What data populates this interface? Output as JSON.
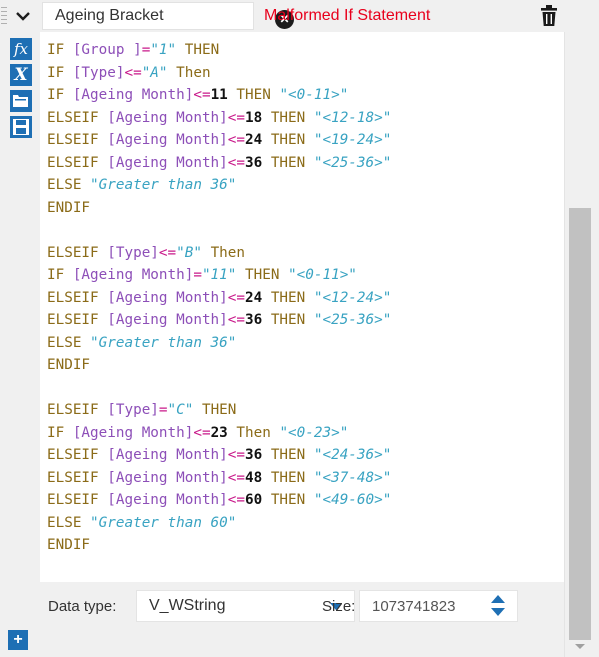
{
  "header": {
    "name_value": "Ageing Bracket",
    "error_message": "Malformed If Statement",
    "error_color": "#e8001c",
    "icons": [
      "chevron-down-icon",
      "error-icon",
      "trash-icon"
    ]
  },
  "toolbar": {
    "fx_glyph": "fx",
    "variable_glyph": "X",
    "add_glyph": "+",
    "icons": [
      "function-icon",
      "variable-icon",
      "folder-icon",
      "save-icon",
      "add-icon"
    ],
    "accent_color": "#1e6fb4"
  },
  "editor": {
    "lines": [
      [
        [
          "k",
          "IF "
        ],
        [
          "f",
          "[Group ]"
        ],
        [
          "o",
          "="
        ],
        [
          "s",
          "\"1\""
        ],
        [
          "k",
          " THEN"
        ]
      ],
      [
        [
          "k",
          "IF "
        ],
        [
          "f",
          "[Type]"
        ],
        [
          "o",
          "<="
        ],
        [
          "s",
          "\"A\""
        ],
        [
          "k",
          " Then"
        ]
      ],
      [
        [
          "k",
          "IF "
        ],
        [
          "f",
          "[Ageing Month]"
        ],
        [
          "o",
          "<="
        ],
        [
          "n",
          "11"
        ],
        [
          "k",
          " THEN "
        ],
        [
          "s",
          "\"<0-11>\""
        ]
      ],
      [
        [
          "k",
          "ELSEIF "
        ],
        [
          "f",
          "[Ageing Month]"
        ],
        [
          "o",
          "<="
        ],
        [
          "n",
          "18"
        ],
        [
          "k",
          " THEN "
        ],
        [
          "s",
          "\"<12-18>\""
        ]
      ],
      [
        [
          "k",
          "ELSEIF "
        ],
        [
          "f",
          "[Ageing Month]"
        ],
        [
          "o",
          "<="
        ],
        [
          "n",
          "24"
        ],
        [
          "k",
          " THEN "
        ],
        [
          "s",
          "\"<19-24>\""
        ]
      ],
      [
        [
          "k",
          "ELSEIF "
        ],
        [
          "f",
          "[Ageing Month]"
        ],
        [
          "o",
          "<="
        ],
        [
          "n",
          "36"
        ],
        [
          "k",
          " THEN "
        ],
        [
          "s",
          "\"<25-36>\""
        ]
      ],
      [
        [
          "k",
          "ELSE "
        ],
        [
          "s",
          "\"Greater than 36\""
        ]
      ],
      [
        [
          "k",
          "ENDIF"
        ]
      ],
      [],
      [
        [
          "k",
          "ELSEIF "
        ],
        [
          "f",
          "[Type]"
        ],
        [
          "o",
          "<="
        ],
        [
          "s",
          "\"B\""
        ],
        [
          "k",
          " Then"
        ]
      ],
      [
        [
          "k",
          "IF "
        ],
        [
          "f",
          "[Ageing Month]"
        ],
        [
          "o",
          "="
        ],
        [
          "s",
          "\"11\""
        ],
        [
          "k",
          " THEN "
        ],
        [
          "s",
          "\"<0-11>\""
        ]
      ],
      [
        [
          "k",
          "ELSEIF "
        ],
        [
          "f",
          "[Ageing Month]"
        ],
        [
          "o",
          "<="
        ],
        [
          "n",
          "24"
        ],
        [
          "k",
          " THEN "
        ],
        [
          "s",
          "\"<12-24>\""
        ]
      ],
      [
        [
          "k",
          "ELSEIF "
        ],
        [
          "f",
          "[Ageing Month]"
        ],
        [
          "o",
          "<="
        ],
        [
          "n",
          "36"
        ],
        [
          "k",
          " THEN "
        ],
        [
          "s",
          "\"<25-36>\""
        ]
      ],
      [
        [
          "k",
          "ELSE "
        ],
        [
          "s",
          "\"Greater than 36\""
        ]
      ],
      [
        [
          "k",
          "ENDIF"
        ]
      ],
      [],
      [
        [
          "k",
          "ELSEIF "
        ],
        [
          "f",
          "[Type]"
        ],
        [
          "o",
          "="
        ],
        [
          "s",
          "\"C\""
        ],
        [
          "k",
          " THEN"
        ]
      ],
      [
        [
          "k",
          "IF "
        ],
        [
          "f",
          "[Ageing Month]"
        ],
        [
          "o",
          "<="
        ],
        [
          "n",
          "23"
        ],
        [
          "k",
          " Then "
        ],
        [
          "s",
          "\"<0-23>\""
        ]
      ],
      [
        [
          "k",
          "ELSEIF "
        ],
        [
          "f",
          "[Ageing Month]"
        ],
        [
          "o",
          "<="
        ],
        [
          "n",
          "36"
        ],
        [
          "k",
          " THEN "
        ],
        [
          "s",
          "\"<24-36>\""
        ]
      ],
      [
        [
          "k",
          "ELSEIF "
        ],
        [
          "f",
          "[Ageing Month]"
        ],
        [
          "o",
          "<="
        ],
        [
          "n",
          "48"
        ],
        [
          "k",
          " THEN "
        ],
        [
          "s",
          "\"<37-48>\""
        ]
      ],
      [
        [
          "k",
          "ELSEIF "
        ],
        [
          "f",
          "[Ageing Month]"
        ],
        [
          "o",
          "<="
        ],
        [
          "n",
          "60"
        ],
        [
          "k",
          " THEN "
        ],
        [
          "s",
          "\"<49-60>\""
        ]
      ],
      [
        [
          "k",
          "ELSE "
        ],
        [
          "s",
          "\"Greater than 60\""
        ]
      ],
      [
        [
          "k",
          "ENDIF"
        ]
      ]
    ],
    "token_colors": {
      "keyword": "#8b6b18",
      "field": "#8d4fb8",
      "operator": "#c8188a",
      "number": "#111111",
      "string": "#39a3c2"
    }
  },
  "settings": {
    "data_type_label": "Data type:",
    "data_type_value": "V_WString",
    "size_label": "Size:",
    "size_value": "1073741823",
    "icons": [
      "dropdown-arrow-icon",
      "spinner-up-icon",
      "spinner-down-icon"
    ]
  }
}
